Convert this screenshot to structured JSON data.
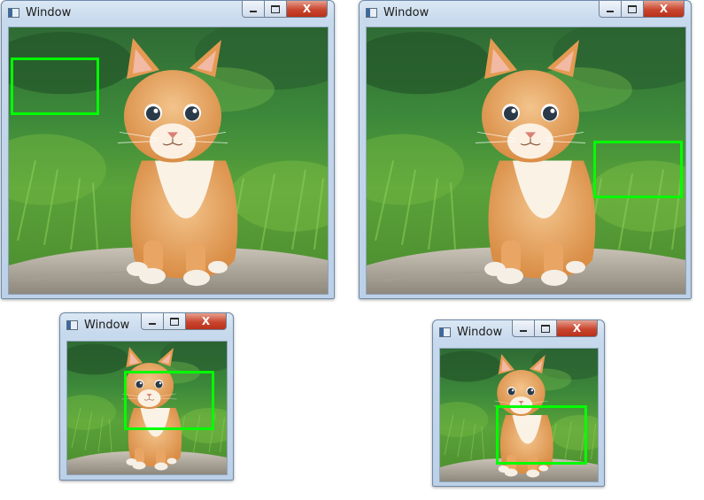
{
  "windows": [
    {
      "title": "Window",
      "roi_label": ""
    },
    {
      "title": "Window",
      "roi_label": ""
    },
    {
      "title": "Window",
      "roi_label": ""
    },
    {
      "title": "Window",
      "roi_label": ""
    }
  ],
  "caption_buttons": {
    "minimize": "",
    "maximize": "",
    "close": "X"
  },
  "colors": {
    "roi": "#00ff00",
    "close": "#c9452e",
    "frame": "#c7d9ec"
  },
  "icons": [
    "app-icon",
    "minimize-icon",
    "maximize-icon",
    "close-icon"
  ]
}
